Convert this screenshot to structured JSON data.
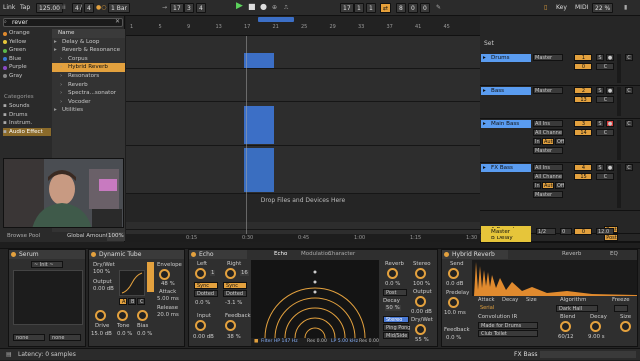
{
  "topbar": {
    "link": "Link",
    "tap": "Tap",
    "tempo": "125.00",
    "meter_num": "4",
    "meter_den": "4",
    "quant": "1 Bar",
    "pos1": "17",
    "pos2": "3",
    "pos3": "4",
    "loop1": "17",
    "loop2": "1",
    "loop3": "1",
    "len1": "8",
    "len2": "0",
    "len3": "0",
    "key": "Key",
    "midi": "MIDI",
    "cpu": "22 %"
  },
  "browser": {
    "search_value": "rever",
    "collections": [
      "Orange",
      "Yellow",
      "Green",
      "Blue",
      "Purple",
      "Gray"
    ],
    "collection_colors": [
      "#e08a2e",
      "#e6c53a",
      "#5cb84a",
      "#3a78d6",
      "#8a4ac4",
      "#888888"
    ],
    "categories_label": "Categories",
    "categories": [
      "Sounds",
      "Drums",
      "Instrum.",
      "Audio Effect"
    ],
    "name_header": "Name",
    "items": [
      "Delay & Loop",
      "Reverb & Resonance",
      "Corpus",
      "Hybrid Reverb",
      "Resonators",
      "Reverb",
      "Spectra...sonator",
      "Vocoder",
      "Utilities"
    ],
    "browse_pool": "Browse Pool",
    "global_amount": "Global Amount",
    "global_amount_value": "100%"
  },
  "arrangement": {
    "ruler_numbers": [
      "1",
      "5",
      "9",
      "13",
      "17",
      "21",
      "25",
      "29",
      "33",
      "37",
      "41",
      "45"
    ],
    "drop_text": "Drop Files and Devices Here",
    "time_labels": [
      "0:15",
      "0:30",
      "0:45",
      "1:00",
      "1:15",
      "1:30"
    ]
  },
  "mixer": {
    "set": "Set",
    "tracks": [
      {
        "name": "Drums",
        "color": "#5a9cf0",
        "route": "Master",
        "vol": "0",
        "pan": "C",
        "num": "1"
      },
      {
        "name": "Bass",
        "color": "#5a9cf0",
        "route": "Master",
        "vol": "13",
        "pan": "C",
        "num": "2"
      },
      {
        "name": "Main Bass",
        "color": "#5a9cf0",
        "route": "All Ins",
        "vol": "14",
        "pan": "C",
        "num": "3",
        "monitor": "Auto",
        "ch": "All Channe",
        "out": "Master"
      },
      {
        "name": "FX Bass",
        "color": "#5a9cf0",
        "route": "All Ins",
        "vol": "15",
        "pan": "C",
        "num": "4",
        "monitor": "Auto",
        "ch": "All Channe",
        "out": "Master"
      }
    ],
    "returns": [
      {
        "name": "A Reverb",
        "color": "#e6c53a",
        "tag": "Post"
      },
      {
        "name": "B Delay",
        "color": "#e6c53a",
        "tag": "Post"
      }
    ],
    "master": {
      "name": "Master",
      "route": "1/2",
      "vol": "0",
      "val": "0",
      "extra": "12.0"
    }
  },
  "devices": {
    "serum": {
      "title": "Serum",
      "preset": "~ Init ~",
      "sel1": "none",
      "sel2": "none"
    },
    "tube": {
      "title": "Dynamic Tube",
      "drywet": "Dry/Wet",
      "drywet_val": "100 %",
      "output": "Output",
      "output_val": "0.00 dB",
      "envelope": "Envelope",
      "env_val": "48 %",
      "attack": "Attack",
      "attack_val": "5.00 ms",
      "release": "Release",
      "release_val": "20.0 ms",
      "drive": "Drive",
      "drive_val": "15.0 dB",
      "tone": "Tone",
      "tone_val": "0.0 %",
      "bias": "Bias",
      "bias_val": "0.0 %",
      "abc": [
        "A",
        "B",
        "C"
      ]
    },
    "echo": {
      "title": "Echo",
      "tabs": [
        "Echo",
        "Modulation",
        "Character"
      ],
      "left": "Left",
      "left_val": "1",
      "right": "Right",
      "right_val": "16",
      "sync": "Sync",
      "dotted": "Dotted",
      "left_off": "0.0 %",
      "right_off": "-3.1 %",
      "input": "Input",
      "input_val": "0.00 dB",
      "feedback": "Feedback",
      "feedback_val": "38 %",
      "reverb": "Reverb",
      "reverb_val": "0.0 %",
      "stereo": "Stereo",
      "stereo_val": "100 %",
      "post": "Post",
      "decay": "Decay",
      "decay_val": "50 %",
      "output": "Output",
      "output_val": "0.00 dB",
      "drywet": "Dry/Wet",
      "drywet_val": "55 %",
      "modes": [
        "Stereo",
        "Ping Pong",
        "Mid/Side"
      ],
      "filter": "Filter HP 147 Hz",
      "res1": "Res 0.00",
      "lp": "LP 5.00 kHz",
      "res2": "Res 0.00"
    },
    "hybrid": {
      "title": "Hybrid Reverb",
      "reverb_tab": "Reverb",
      "eq_tab": "EQ",
      "send": "Send",
      "send_val": "0.0 dB",
      "predelay": "Predelay",
      "predelay_val": "10.0 ms",
      "feedback": "Feedback",
      "feedback_val": "0.0 %",
      "env": [
        "Attack",
        "Decay",
        "Size"
      ],
      "algorithm": "Algorithm",
      "algorithm_val": "Dark Hall",
      "freeze": "Freeze",
      "serial": "Serial",
      "convolution": "Convolution IR",
      "made_for": "Made for Drums",
      "club": "Club Toilet",
      "blend": "Blend",
      "blend_val": "60/12",
      "decay2": "Decay",
      "decay2_val": "9.00 s",
      "size": "Size"
    }
  },
  "status": {
    "latency": "Latency: 0 samples",
    "track": "FX Bass"
  }
}
